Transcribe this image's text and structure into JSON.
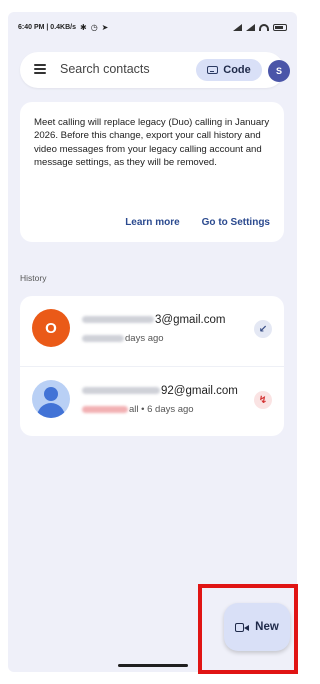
{
  "status_bar": {
    "time_and_speed": "6:40 PM | 0.4KB/s"
  },
  "search": {
    "placeholder": "Search contacts",
    "code_label": "Code",
    "avatar_initial": "S"
  },
  "notice": {
    "text": "Meet calling will replace legacy (Duo) calling in January 2026. Before this change, export your call history and video messages from your legacy calling account and message settings, as they will be removed.",
    "learn_more": "Learn more",
    "go_to_settings": "Go to Settings"
  },
  "history": {
    "section_label": "History",
    "entries": [
      {
        "avatar_initial": "O",
        "avatar_color": "#ea5a18",
        "email_visible": "3@gmail.com",
        "subtitle_visible": "days ago",
        "call_type_icon": "incoming-call-icon"
      },
      {
        "avatar_initial": "",
        "avatar_color": "#4273d6",
        "email_visible": "92@gmail.com",
        "subtitle_visible": "all • 6 days ago",
        "call_type_icon": "missed-call-icon"
      }
    ]
  },
  "fab": {
    "label": "New",
    "icon": "video-call-icon"
  },
  "colors": {
    "background": "#eff0f9",
    "accent_container": "#d9e0f7",
    "highlight_box": "#e01414"
  }
}
